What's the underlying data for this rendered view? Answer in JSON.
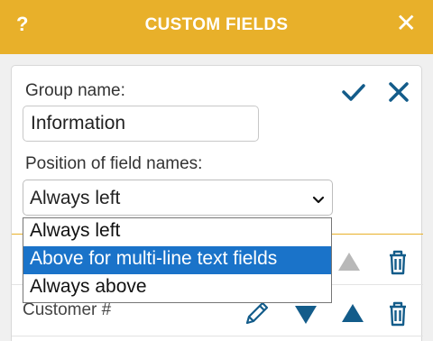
{
  "header": {
    "help": "?",
    "title": "CUSTOM FIELDS",
    "close": "✕"
  },
  "form": {
    "group_label": "Group name:",
    "group_value": "Information",
    "position_label": "Position of field names:",
    "position_value": "Always left",
    "position_options": [
      "Always left",
      "Above for multi-line text fields",
      "Always above"
    ],
    "selected_option_index": 1
  },
  "rows": [
    {
      "label": ""
    },
    {
      "label": "Customer #"
    }
  ],
  "colors": {
    "header": "#e8b02a",
    "accent": "#135c8a",
    "selected": "#1a73c9"
  }
}
